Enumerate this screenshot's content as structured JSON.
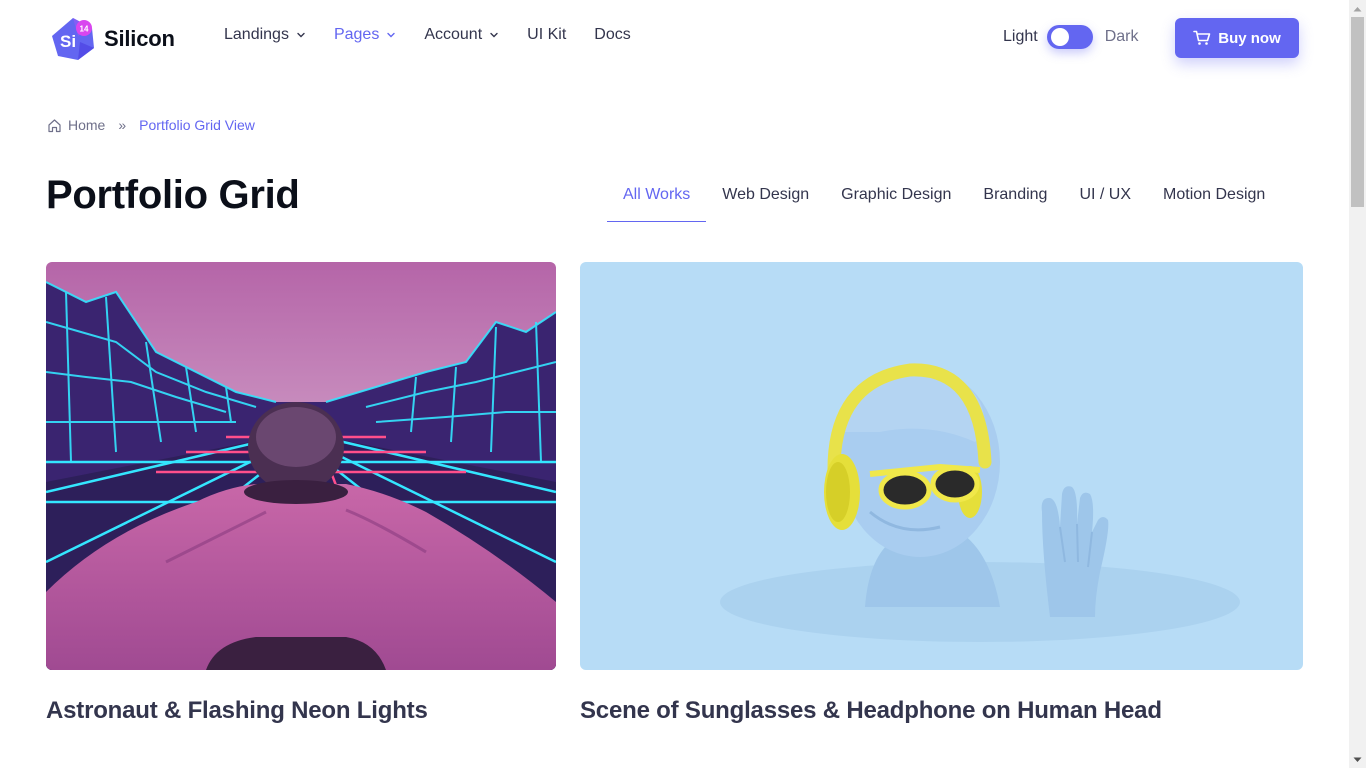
{
  "header": {
    "logo_badge_text": "Si",
    "logo_badge_version": "14",
    "logo_text": "Silicon",
    "nav": [
      {
        "label": "Landings",
        "has_dropdown": true,
        "active": false
      },
      {
        "label": "Pages",
        "has_dropdown": true,
        "active": true
      },
      {
        "label": "Account",
        "has_dropdown": true,
        "active": false
      },
      {
        "label": "UI Kit",
        "has_dropdown": false,
        "active": false
      },
      {
        "label": "Docs",
        "has_dropdown": false,
        "active": false
      }
    ],
    "mode_light_label": "Light",
    "mode_dark_label": "Dark",
    "buy_label": "Buy now"
  },
  "breadcrumb": {
    "home": "Home",
    "separator": "»",
    "current": "Portfolio Grid View"
  },
  "page": {
    "title": "Portfolio Grid"
  },
  "tabs": [
    {
      "label": "All Works",
      "active": true
    },
    {
      "label": "Web Design",
      "active": false
    },
    {
      "label": "Graphic Design",
      "active": false
    },
    {
      "label": "Branding",
      "active": false
    },
    {
      "label": "UI / UX",
      "active": false
    },
    {
      "label": "Motion Design",
      "active": false
    }
  ],
  "cards": [
    {
      "title": "Astronaut & Flashing Neon Lights",
      "image": "astronaut-neon-grid-image"
    },
    {
      "title": "Scene of Sunglasses & Headphone on Human Head",
      "image": "sunglasses-headphone-head-image"
    }
  ],
  "colors": {
    "accent": "#6366f1",
    "heading": "#0b0f19",
    "body": "#33354d",
    "muted": "#6f708a"
  }
}
